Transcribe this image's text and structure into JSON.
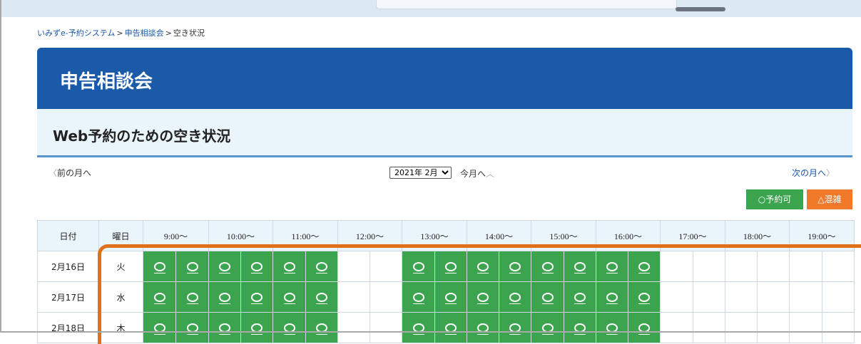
{
  "breadcrumb": {
    "home": "いみずe-予約システム",
    "sep": ">",
    "category": "申告相談会",
    "current": "空き状況"
  },
  "page_title": "申告相談会",
  "section_title": "Web予約のための空き状況",
  "nav": {
    "prev_chev": "〈",
    "prev": "前の月へ",
    "this_month": "今月へ",
    "up_chev": "︿",
    "next": "次の月へ",
    "next_chev": "〉",
    "month_options": [
      "2021年 2月"
    ],
    "selected_month": "2021年 2月"
  },
  "legend": {
    "available": "○予約可",
    "busy": "△混雑"
  },
  "colors": {
    "brand": "#1b5aa8",
    "available": "#3ca34e",
    "busy": "#f07a2a",
    "highlight": "#e0701a"
  },
  "table": {
    "date_header": "日付",
    "weekday_header": "曜日",
    "time_headers": [
      "9:00～",
      "10:00～",
      "11:00～",
      "12:00～",
      "13:00～",
      "14:00～",
      "15:00～",
      "16:00～",
      "17:00～",
      "18:00～",
      "19:00～"
    ],
    "rows": [
      {
        "date": "2月16日",
        "weekday": "火",
        "slots": [
          "○",
          "○",
          "○",
          "○",
          "○",
          "○",
          "",
          "",
          "○",
          "○",
          "○",
          "○",
          "○",
          "○",
          "○",
          "○",
          "",
          "",
          "",
          "",
          "",
          ""
        ]
      },
      {
        "date": "2月17日",
        "weekday": "水",
        "slots": [
          "○",
          "○",
          "○",
          "○",
          "○",
          "○",
          "",
          "",
          "○",
          "○",
          "○",
          "○",
          "○",
          "○",
          "○",
          "○",
          "",
          "",
          "",
          "",
          "",
          ""
        ]
      },
      {
        "date": "2月18日",
        "weekday": "木",
        "slots": [
          "○",
          "○",
          "○",
          "○",
          "○",
          "○",
          "",
          "",
          "○",
          "○",
          "○",
          "○",
          "○",
          "○",
          "○",
          "○",
          "",
          "",
          "",
          "",
          "",
          ""
        ]
      }
    ]
  }
}
